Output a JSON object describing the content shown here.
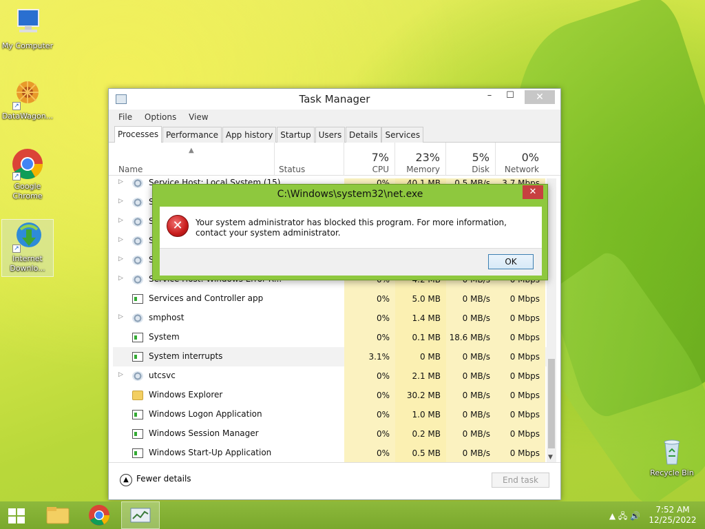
{
  "desktop": {
    "icons": [
      {
        "label": "My Computer",
        "icon": "computer-icon"
      },
      {
        "label": "DataWagon...",
        "icon": "datawagon-icon"
      },
      {
        "label": "Google Chrome",
        "icon": "chrome-icon"
      },
      {
        "label": "Internet Downlo...",
        "icon": "idm-icon"
      },
      {
        "label": "Recycle Bin",
        "icon": "recycle-bin-icon"
      }
    ]
  },
  "task_manager": {
    "title": "Task Manager",
    "menu": [
      "File",
      "Options",
      "View"
    ],
    "tabs": [
      "Processes",
      "Performance",
      "App history",
      "Startup",
      "Users",
      "Details",
      "Services"
    ],
    "active_tab": "Processes",
    "columns": {
      "name": "Name",
      "status": "Status",
      "cpu": {
        "pct": "7%",
        "label": "CPU"
      },
      "memory": {
        "pct": "23%",
        "label": "Memory"
      },
      "disk": {
        "pct": "5%",
        "label": "Disk"
      },
      "network": {
        "pct": "0%",
        "label": "Network"
      }
    },
    "rows": [
      {
        "name": "Service Host: Local System (15)",
        "cpu": "0%",
        "mem": "40.1 MB",
        "disk": "0.5 MB/s",
        "net": "3.7 Mbps",
        "icon": "service-icon",
        "expand": true
      },
      {
        "name": "Se",
        "cpu": "",
        "mem": "",
        "disk": "",
        "net": "",
        "icon": "service-icon",
        "expand": true
      },
      {
        "name": "Se",
        "cpu": "",
        "mem": "",
        "disk": "",
        "net": "",
        "icon": "service-icon",
        "expand": true
      },
      {
        "name": "Se",
        "cpu": "",
        "mem": "",
        "disk": "",
        "net": "",
        "icon": "service-icon",
        "expand": true
      },
      {
        "name": "Se",
        "cpu": "",
        "mem": "",
        "disk": "",
        "net": "",
        "icon": "service-icon",
        "expand": true
      },
      {
        "name": "Service Host: Windows Error R...",
        "cpu": "0%",
        "mem": "4.2 MB",
        "disk": "0 MB/s",
        "net": "0 Mbps",
        "icon": "service-icon",
        "expand": true
      },
      {
        "name": "Services and Controller app",
        "cpu": "0%",
        "mem": "5.0 MB",
        "disk": "0 MB/s",
        "net": "0 Mbps",
        "icon": "app-icon",
        "expand": false
      },
      {
        "name": "smphost",
        "cpu": "0%",
        "mem": "1.4 MB",
        "disk": "0 MB/s",
        "net": "0 Mbps",
        "icon": "service-icon",
        "expand": true
      },
      {
        "name": "System",
        "cpu": "0%",
        "mem": "0.1 MB",
        "disk": "18.6 MB/s",
        "net": "0 Mbps",
        "icon": "app-icon",
        "expand": false
      },
      {
        "name": "System interrupts",
        "cpu": "3.1%",
        "mem": "0 MB",
        "disk": "0 MB/s",
        "net": "0 Mbps",
        "icon": "app-icon",
        "expand": false,
        "highlight": true
      },
      {
        "name": "utcsvc",
        "cpu": "0%",
        "mem": "2.1 MB",
        "disk": "0 MB/s",
        "net": "0 Mbps",
        "icon": "service-icon",
        "expand": true
      },
      {
        "name": "Windows Explorer",
        "cpu": "0%",
        "mem": "30.2 MB",
        "disk": "0 MB/s",
        "net": "0 Mbps",
        "icon": "folder-icon",
        "expand": false
      },
      {
        "name": "Windows Logon Application",
        "cpu": "0%",
        "mem": "1.0 MB",
        "disk": "0 MB/s",
        "net": "0 Mbps",
        "icon": "app-icon",
        "expand": false
      },
      {
        "name": "Windows Session Manager",
        "cpu": "0%",
        "mem": "0.2 MB",
        "disk": "0 MB/s",
        "net": "0 Mbps",
        "icon": "app-icon",
        "expand": false
      },
      {
        "name": "Windows Start-Up Application",
        "cpu": "0%",
        "mem": "0.5 MB",
        "disk": "0 MB/s",
        "net": "0 Mbps",
        "icon": "app-icon",
        "expand": false
      }
    ],
    "footer": {
      "fewer_details": "Fewer details",
      "end_task": "End task"
    }
  },
  "error_dialog": {
    "title": "C:\\Windows\\system32\\net.exe",
    "message": "Your system administrator has blocked this program. For more information, contact your system administrator.",
    "ok_label": "OK",
    "icon": "error-icon"
  },
  "taskbar": {
    "time": "7:52 AM",
    "date": "12/25/2022",
    "items": [
      "start-button",
      "file-explorer",
      "google-chrome",
      "task-manager"
    ]
  },
  "colors": {
    "accent": "#8ec83e",
    "taskbar": "#7aa82c",
    "error": "#c81c1c"
  }
}
